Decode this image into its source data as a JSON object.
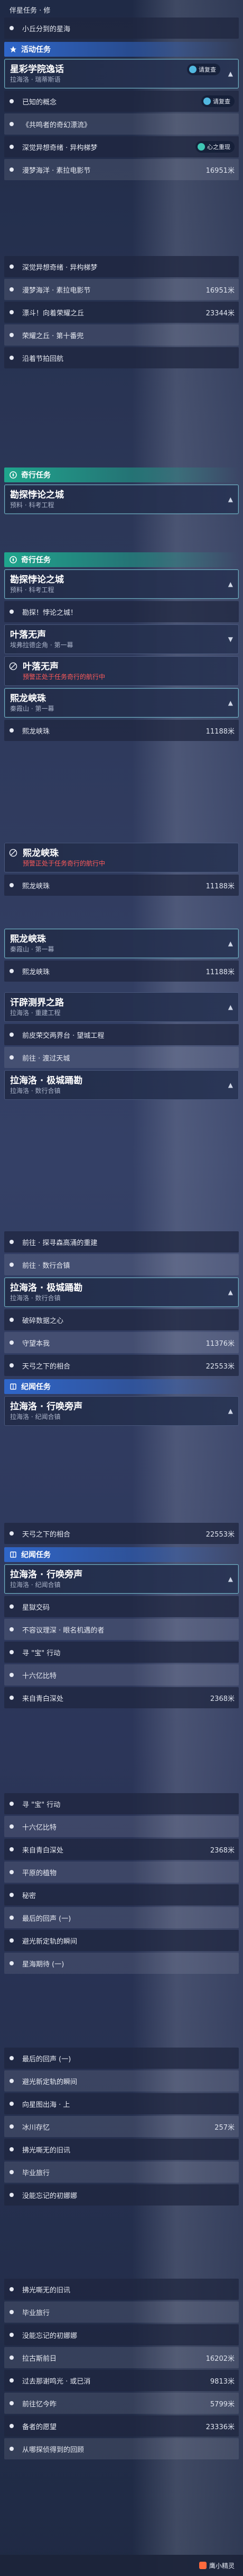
{
  "strip1": {
    "top_label": "伴星任务 · 修",
    "row_small_star": "小丘分到的星海",
    "section_event": "活动任务",
    "card1_title": "星彩学院逸话",
    "card1_sub": "拉海洛 · 瑞蒂斯语",
    "card1_badge_text": "请复查",
    "card1_badge_text2": "请复查",
    "rows": [
      {
        "label": "已知的概念",
        "dist": ""
      },
      {
        "label": "《共鸣者的奇幻漂流》",
        "dist": ""
      },
      {
        "label": "深觉异想奇绪 · 异构梯梦",
        "dist": ""
      },
      {
        "label": "漫梦海洋 · 素拉电影节",
        "dist": "16951米"
      }
    ],
    "badge2": "心之重现",
    "status_extra": "完成"
  },
  "strip2": {
    "rows": [
      {
        "label": "深觉异想奇绪 · 异构梯梦",
        "dist": ""
      },
      {
        "label": "漫梦海洋 · 素拉电影节",
        "dist": "16951米"
      },
      {
        "label": "漂斗！向着荣耀之丘",
        "dist": "23344米"
      },
      {
        "label": "荣耀之丘 · 第十番兜",
        "dist": ""
      },
      {
        "label": "沿着节拍回航",
        "dist": ""
      }
    ]
  },
  "strip3": {
    "section_main": "奇行任务",
    "card_title": "勘探悖论之城",
    "card_sub": "预料 · 科考工程"
  },
  "strip4": {
    "section_main": "奇行任务",
    "card_title": "勘探悖论之城",
    "card_sub": "预料 · 科考工程",
    "row1": "勘探！悖论之城！",
    "card2_title": "叶落无声",
    "card2_sub": "埃弗拉德企角 · 第一幕",
    "card3_title": "叶落无声",
    "card3_warn": "预警正处于任务奇行的航行中",
    "card4_title": "熙龙峡珠",
    "card4_sub": "秦霞山 · 第一幕",
    "row2": "熙龙峡珠",
    "row2_dist": "11188米"
  },
  "strip5": {
    "card1_title": "熙龙峡珠",
    "card1_warn": "预警正处于任务奇行的航行中",
    "row1": "熙龙峡珠",
    "row1_dist": "11188米"
  },
  "strip6": {
    "card1_title": "熙龙峡珠",
    "card1_sub": "秦霞山 · 第一幕",
    "row1": "熙龙峡珠",
    "row1_dist": "11188米",
    "card2_title": "讦辟测界之路",
    "card2_sub": "拉海洛 · 重建工程",
    "rows": [
      {
        "label": "前皮荣交两界台 · 望城工程",
        "dist": ""
      },
      {
        "label": "前往 · 渡过天城",
        "dist": ""
      }
    ],
    "card3_title": "拉海洛 · 极城踊勘",
    "card3_sub": "拉海洛 · 数行合镇"
  },
  "strip7": {
    "rows_top": [
      {
        "label": "前往 · 探寻森高涌的重建",
        "dist": ""
      },
      {
        "label": "前往 · 数行合镇",
        "dist": ""
      }
    ],
    "card_title": "拉海洛 · 极城踊勘",
    "card_sub": "拉海洛 · 数行合镇",
    "rows": [
      {
        "label": "破碎数据之心",
        "dist": ""
      },
      {
        "label": "守望本我",
        "dist": "11376米"
      },
      {
        "label": "天弓之下的相合",
        "dist": "22553米"
      }
    ],
    "section_record": "纪闻任务",
    "card2_title": "拉海洛 · 行唤旁声",
    "card2_sub": "拉海洛 · 纪闻合镇"
  },
  "strip8": {
    "row_first": "天弓之下的相合",
    "row_first_dist": "22553米",
    "section_record": "纪闻任务",
    "card_title": "拉海洛 · 行唤旁声",
    "card_sub": "拉海洛 · 纪闻合镇",
    "rows": [
      {
        "label": "星獄交码",
        "dist": ""
      },
      {
        "label": "不容议理深 · 眼名机遇的者",
        "dist": ""
      },
      {
        "label": "寻 \"宝\" 行动",
        "dist": ""
      },
      {
        "label": "十六亿比特",
        "dist": ""
      },
      {
        "label": "来自青白深处",
        "dist": "2368米"
      }
    ]
  },
  "strip9": {
    "rows": [
      {
        "label": "寻 \"宝\" 行动",
        "dist": ""
      },
      {
        "label": "十六亿比特",
        "dist": ""
      },
      {
        "label": "来自青白深处",
        "dist": "2368米"
      },
      {
        "label": "平原的植物",
        "dist": ""
      },
      {
        "label": "秘密",
        "dist": ""
      },
      {
        "label": "最后的回声 (一)",
        "dist": ""
      },
      {
        "label": "避光新定轨的瞬间",
        "dist": ""
      },
      {
        "label": "星海期待 (一)",
        "dist": ""
      }
    ]
  },
  "strip10": {
    "rows": [
      {
        "label": "最后的回声 (一)",
        "dist": ""
      },
      {
        "label": "避光新定轨的瞬间",
        "dist": ""
      },
      {
        "label": "向星图出海 · 上",
        "dist": ""
      },
      {
        "label": "冰川存忆",
        "dist": "257米"
      },
      {
        "label": "拂光嘶无的旧讯",
        "dist": ""
      },
      {
        "label": "毕业旅行",
        "dist": ""
      },
      {
        "label": "没能忘记的初娜娜",
        "dist": ""
      }
    ]
  },
  "strip11": {
    "rows": [
      {
        "label": "拂光嘶无的旧讯",
        "dist": ""
      },
      {
        "label": "毕业旅行",
        "dist": ""
      },
      {
        "label": "没能忘记的初娜娜",
        "dist": ""
      },
      {
        "label": "拉古斯前日",
        "dist": "16202米"
      },
      {
        "label": "过去那谢鸣光 · 或已消",
        "dist": "9813米"
      },
      {
        "label": "前往忆今昨",
        "dist": "5799米"
      },
      {
        "label": "备者的愿望",
        "dist": "23336米"
      },
      {
        "label": "从哪探侦得到的回顾",
        "dist": ""
      }
    ]
  },
  "bottom_nav": {
    "brand": "鹰小精灵"
  }
}
